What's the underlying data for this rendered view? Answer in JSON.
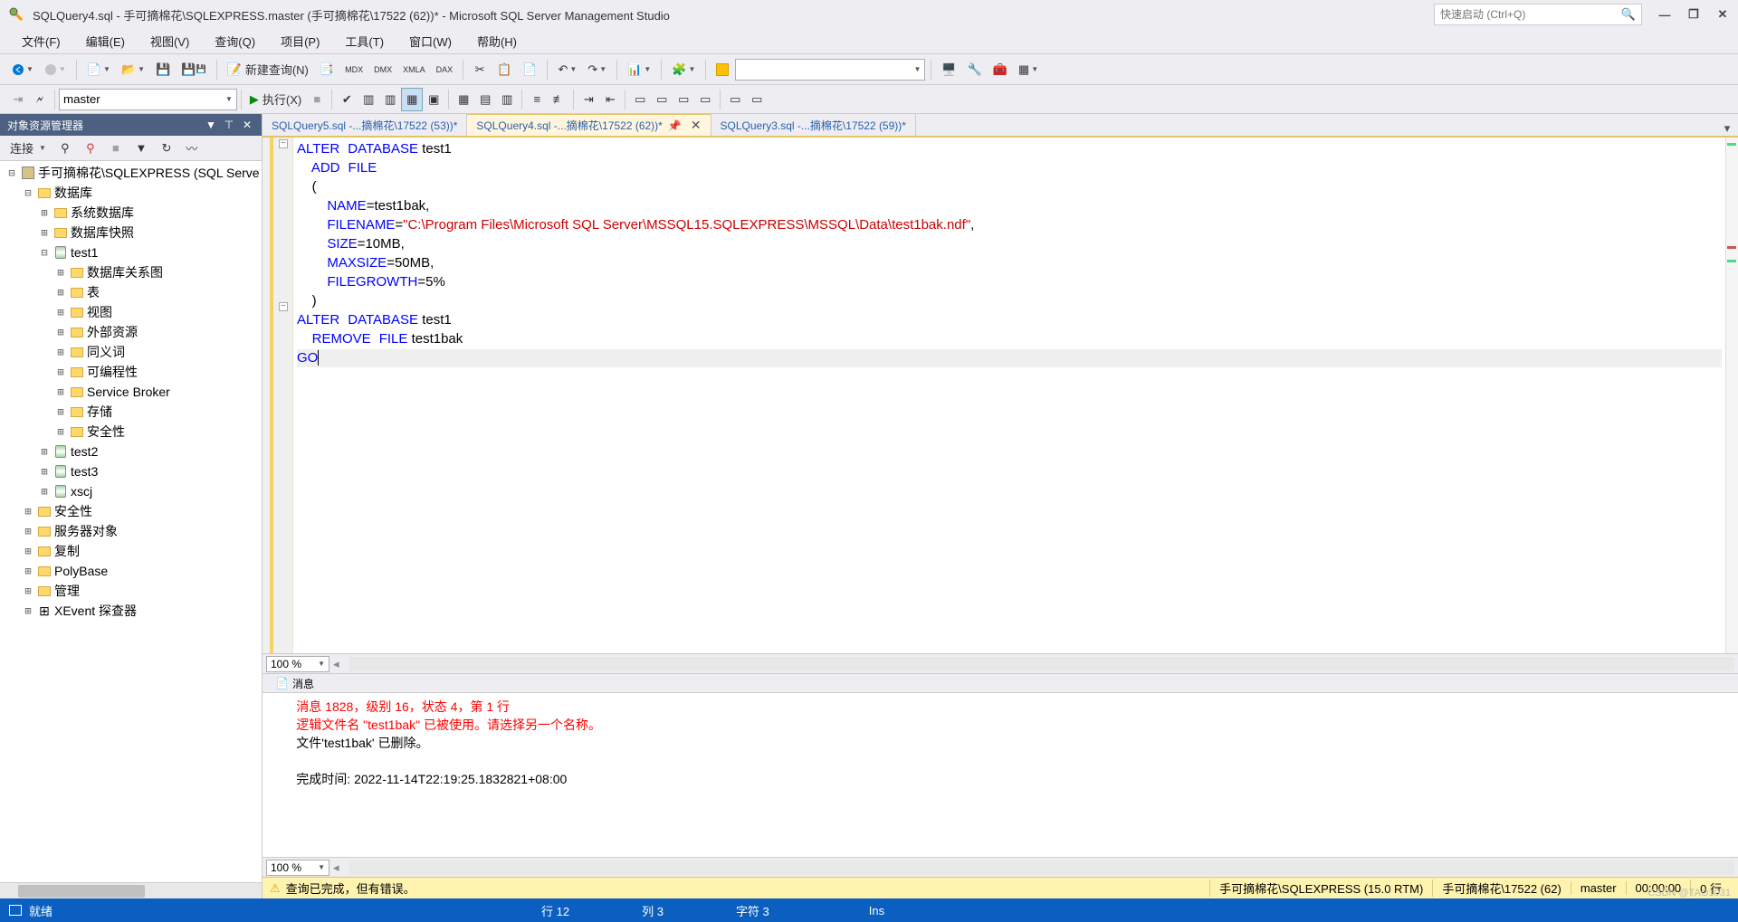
{
  "title": "SQLQuery4.sql - 手可摘棉花\\SQLEXPRESS.master (手可摘棉花\\17522 (62))* - Microsoft SQL Server Management Studio",
  "quick_launch": {
    "placeholder": "快速启动 (Ctrl+Q)"
  },
  "menu": [
    "文件(F)",
    "编辑(E)",
    "视图(V)",
    "查询(Q)",
    "项目(P)",
    "工具(T)",
    "窗口(W)",
    "帮助(H)"
  ],
  "toolbar1": {
    "new_query": "新建查询(N)"
  },
  "toolbar2": {
    "db_combo": "master",
    "execute": "执行(X)"
  },
  "explorer": {
    "title": "对象资源管理器",
    "connect": "连接",
    "tree": [
      {
        "d": 0,
        "exp": "⊟",
        "icon": "server",
        "label": "手可摘棉花\\SQLEXPRESS (SQL Serve"
      },
      {
        "d": 1,
        "exp": "⊟",
        "icon": "folder",
        "label": "数据库"
      },
      {
        "d": 2,
        "exp": "⊞",
        "icon": "folder",
        "label": "系统数据库"
      },
      {
        "d": 2,
        "exp": "⊞",
        "icon": "folder",
        "label": "数据库快照"
      },
      {
        "d": 2,
        "exp": "⊟",
        "icon": "db",
        "label": "test1"
      },
      {
        "d": 3,
        "exp": "⊞",
        "icon": "folder",
        "label": "数据库关系图"
      },
      {
        "d": 3,
        "exp": "⊞",
        "icon": "folder",
        "label": "表"
      },
      {
        "d": 3,
        "exp": "⊞",
        "icon": "folder",
        "label": "视图"
      },
      {
        "d": 3,
        "exp": "⊞",
        "icon": "folder",
        "label": "外部资源"
      },
      {
        "d": 3,
        "exp": "⊞",
        "icon": "folder",
        "label": "同义词"
      },
      {
        "d": 3,
        "exp": "⊞",
        "icon": "folder",
        "label": "可编程性"
      },
      {
        "d": 3,
        "exp": "⊞",
        "icon": "folder",
        "label": "Service Broker"
      },
      {
        "d": 3,
        "exp": "⊞",
        "icon": "folder",
        "label": "存储"
      },
      {
        "d": 3,
        "exp": "⊞",
        "icon": "folder",
        "label": "安全性"
      },
      {
        "d": 2,
        "exp": "⊞",
        "icon": "db",
        "label": "test2"
      },
      {
        "d": 2,
        "exp": "⊞",
        "icon": "db",
        "label": "test3"
      },
      {
        "d": 2,
        "exp": "⊞",
        "icon": "db",
        "label": "xscj"
      },
      {
        "d": 1,
        "exp": "⊞",
        "icon": "folder",
        "label": "安全性"
      },
      {
        "d": 1,
        "exp": "⊞",
        "icon": "folder",
        "label": "服务器对象"
      },
      {
        "d": 1,
        "exp": "⊞",
        "icon": "folder",
        "label": "复制"
      },
      {
        "d": 1,
        "exp": "⊞",
        "icon": "folder",
        "label": "PolyBase"
      },
      {
        "d": 1,
        "exp": "⊞",
        "icon": "folder",
        "label": "管理"
      },
      {
        "d": 1,
        "exp": "⊞",
        "icon": "xevent",
        "label": "XEvent 探查器"
      }
    ]
  },
  "tabs": [
    {
      "label": "SQLQuery5.sql -...摘棉花\\17522 (53))*",
      "active": false
    },
    {
      "label": "SQLQuery4.sql -...摘棉花\\17522 (62))*",
      "active": true
    },
    {
      "label": "SQLQuery3.sql -...摘棉花\\17522 (59))*",
      "active": false
    }
  ],
  "code": {
    "l1a": "ALTER",
    "l1b": "DATABASE",
    "l1c": " test1",
    "l2a": "    ADD",
    "l2b": "FILE",
    "l3": "    (",
    "l4a": "        NAME",
    "l4b": "=",
    "l4c": "test1bak",
    "l4d": ",",
    "l5a": "        FILENAME",
    "l5b": "=",
    "l5c": "\"C:\\Program Files\\Microsoft SQL Server\\MSSQL15.SQLEXPRESS\\MSSQL\\Data\\test1bak.ndf\"",
    "l5d": ",",
    "l6a": "        SIZE",
    "l6b": "=",
    "l6c": "10MB",
    "l6d": ",",
    "l7a": "        MAXSIZE",
    "l7b": "=",
    "l7c": "50MB",
    "l7d": ",",
    "l8a": "        FILEGROWTH",
    "l8b": "=",
    "l8c": "5",
    "l8d": "%",
    "l9": "    )",
    "l10a": "ALTER",
    "l10b": "DATABASE",
    "l10c": " test1",
    "l11a": "    REMOVE",
    "l11b": "FILE",
    "l11c": " test1bak",
    "l12": "GO"
  },
  "zoom": "100 %",
  "messages": {
    "tab": "消息",
    "line1": "消息 1828，级别 16，状态 4，第 1 行",
    "line2": "逻辑文件名 \"test1bak\" 已被使用。请选择另一个名称。",
    "line3": "文件'test1bak' 已删除。",
    "blank": "",
    "line4": "完成时间: 2022-11-14T22:19:25.1832821+08:00"
  },
  "query_status": {
    "msg": "查询已完成，但有错误。",
    "server": "手可摘棉花\\SQLEXPRESS (15.0 RTM)",
    "user": "手可摘棉花\\17522 (62)",
    "db": "master",
    "time": "00:00:00",
    "rows": "0 行"
  },
  "app_status": {
    "ready": "就绪",
    "line": "行 12",
    "col": "列 3",
    "char": "字符 3",
    "ins": "Ins"
  },
  "watermark": "CSDN @TAO1031"
}
